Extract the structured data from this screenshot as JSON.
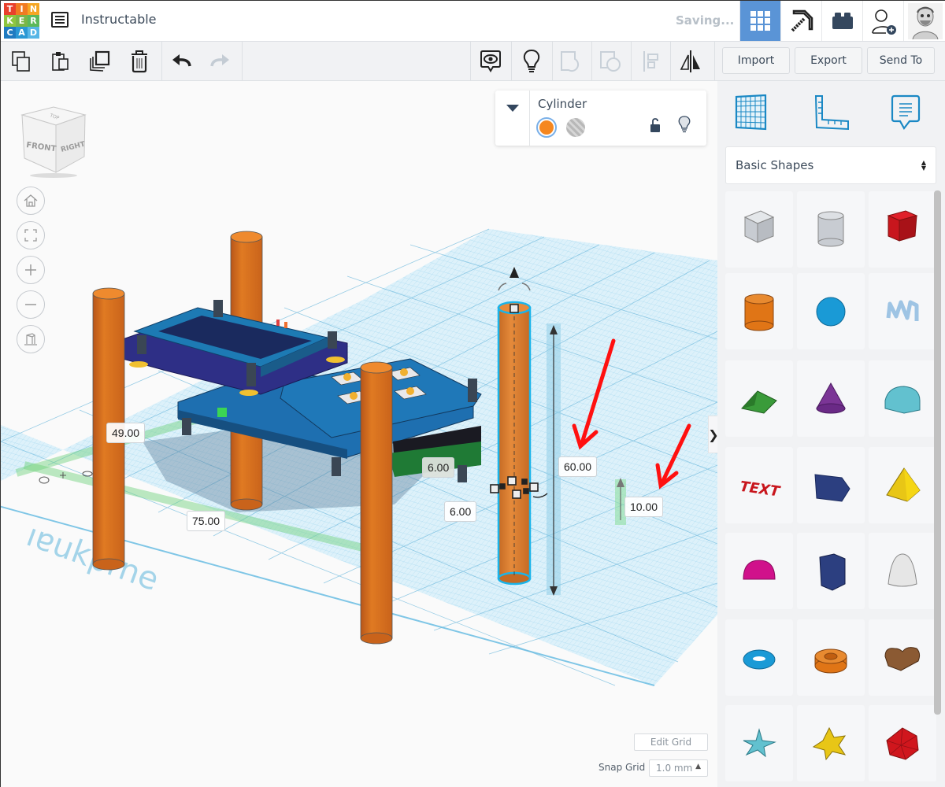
{
  "app": {
    "logo_letters": [
      "T",
      "I",
      "N",
      "K",
      "E",
      "R",
      "C",
      "A",
      "D"
    ],
    "logo_colors": [
      "#e8402c",
      "#f07b22",
      "#f5a623",
      "#8dc63f",
      "#7ab648",
      "#5bb85a",
      "#1f7bc1",
      "#2a98d4",
      "#57b6e6"
    ],
    "document_title": "Instructable",
    "status": "Saving..."
  },
  "header": {
    "buttons": [
      {
        "name": "3d-design-view",
        "icon": "grid-icon",
        "active": true
      },
      {
        "name": "minecraft-view",
        "icon": "pickaxe-icon",
        "active": false
      },
      {
        "name": "lego-bricks-view",
        "icon": "brick-icon",
        "active": false
      },
      {
        "name": "invite-user",
        "icon": "add-user-icon",
        "active": false
      },
      {
        "name": "profile",
        "icon": "avatar-icon",
        "active": false
      }
    ]
  },
  "toolbar": {
    "left_tools": [
      {
        "name": "copy",
        "icon": "copy-icon"
      },
      {
        "name": "paste",
        "icon": "paste-icon"
      },
      {
        "name": "duplicate",
        "icon": "duplicate-icon"
      },
      {
        "name": "delete",
        "icon": "trash-icon"
      }
    ],
    "history_tools": [
      {
        "name": "undo",
        "icon": "undo-icon",
        "enabled": true
      },
      {
        "name": "redo",
        "icon": "redo-icon",
        "enabled": false
      }
    ],
    "right_tools": [
      {
        "name": "show-all",
        "icon": "eye-bubble-icon",
        "enabled": true
      },
      {
        "name": "notes",
        "icon": "lightbulb-icon",
        "enabled": true
      },
      {
        "name": "group",
        "icon": "group-icon",
        "enabled": false
      },
      {
        "name": "ungroup",
        "icon": "ungroup-icon",
        "enabled": false
      },
      {
        "name": "align",
        "icon": "align-icon",
        "enabled": false
      },
      {
        "name": "mirror",
        "icon": "mirror-icon",
        "enabled": true
      }
    ],
    "import_label": "Import",
    "export_label": "Export",
    "send_to_label": "Send To"
  },
  "viewcube": {
    "front": "FRONT",
    "right": "RIGHT",
    "top": "TOP"
  },
  "nav_controls": [
    {
      "name": "home-view",
      "icon": "home-icon"
    },
    {
      "name": "fit-view",
      "icon": "fit-icon"
    },
    {
      "name": "zoom-in",
      "icon": "plus-icon"
    },
    {
      "name": "zoom-out",
      "icon": "minus-icon"
    },
    {
      "name": "perspective-toggle",
      "icon": "ortho-icon"
    }
  ],
  "inspector": {
    "shape_name": "Cylinder",
    "solid_color": "#f5871f",
    "hole_option": "hole",
    "locked": false
  },
  "dimensions": {
    "width_label": "49.00",
    "length_label": "75.00",
    "diameter_x": "6.00",
    "diameter_y": "6.00",
    "height": "60.00",
    "elevation": "10.00"
  },
  "workplane_footer": {
    "edit_grid_label": "Edit Grid",
    "snap_grid_label": "Snap Grid",
    "snap_grid_value": "1.0 mm"
  },
  "panel": {
    "tabs": [
      {
        "name": "workplane-tab",
        "icon": "workplane-icon"
      },
      {
        "name": "ruler-tab",
        "icon": "ruler-icon"
      },
      {
        "name": "notes-tab",
        "icon": "note-bubble-icon"
      }
    ],
    "category": "Basic Shapes",
    "shapes": [
      {
        "name": "box-hole",
        "color": "#c8ccd2"
      },
      {
        "name": "cylinder-hole",
        "color": "#c8ccd2"
      },
      {
        "name": "box",
        "color": "#c8161d"
      },
      {
        "name": "cylinder",
        "color": "#e07516"
      },
      {
        "name": "sphere",
        "color": "#1a9ad6"
      },
      {
        "name": "scribble",
        "color": "#9ec4e4"
      },
      {
        "name": "roof",
        "color": "#3a9b3a"
      },
      {
        "name": "cone",
        "color": "#7b3596"
      },
      {
        "name": "round-roof",
        "color": "#62c1cf"
      },
      {
        "name": "text",
        "color": "#c8161d"
      },
      {
        "name": "wedge",
        "color": "#2c3f80"
      },
      {
        "name": "pyramid",
        "color": "#e8c616"
      },
      {
        "name": "half-sphere",
        "color": "#d0118b"
      },
      {
        "name": "polygon",
        "color": "#2c3f80"
      },
      {
        "name": "paraboloid",
        "color": "#e6e6e6"
      },
      {
        "name": "torus",
        "color": "#1a9ad6"
      },
      {
        "name": "tube",
        "color": "#e07516"
      },
      {
        "name": "heart",
        "color": "#8b5a33"
      },
      {
        "name": "star",
        "color": "#62c1cf"
      },
      {
        "name": "star-six",
        "color": "#e8c616"
      },
      {
        "name": "icosahedron",
        "color": "#d0161d"
      }
    ]
  },
  "colors": {
    "accent": "#5a94d6",
    "workplane_grid": "#8fd0ee",
    "object_orange": "#d96e1c",
    "annotation_red": "#ff0000"
  }
}
